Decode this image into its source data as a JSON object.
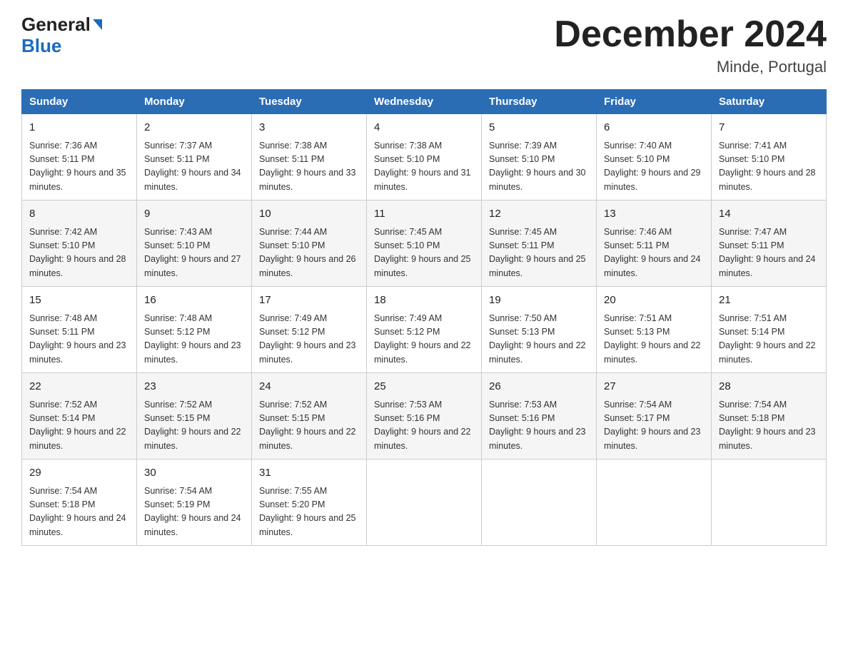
{
  "header": {
    "logo_line1": "General",
    "logo_line2": "Blue",
    "month_title": "December 2024",
    "location": "Minde, Portugal"
  },
  "days_of_week": [
    "Sunday",
    "Monday",
    "Tuesday",
    "Wednesday",
    "Thursday",
    "Friday",
    "Saturday"
  ],
  "weeks": [
    [
      {
        "day": 1,
        "sunrise": "7:36 AM",
        "sunset": "5:11 PM",
        "daylight": "9 hours and 35 minutes."
      },
      {
        "day": 2,
        "sunrise": "7:37 AM",
        "sunset": "5:11 PM",
        "daylight": "9 hours and 34 minutes."
      },
      {
        "day": 3,
        "sunrise": "7:38 AM",
        "sunset": "5:11 PM",
        "daylight": "9 hours and 33 minutes."
      },
      {
        "day": 4,
        "sunrise": "7:38 AM",
        "sunset": "5:10 PM",
        "daylight": "9 hours and 31 minutes."
      },
      {
        "day": 5,
        "sunrise": "7:39 AM",
        "sunset": "5:10 PM",
        "daylight": "9 hours and 30 minutes."
      },
      {
        "day": 6,
        "sunrise": "7:40 AM",
        "sunset": "5:10 PM",
        "daylight": "9 hours and 29 minutes."
      },
      {
        "day": 7,
        "sunrise": "7:41 AM",
        "sunset": "5:10 PM",
        "daylight": "9 hours and 28 minutes."
      }
    ],
    [
      {
        "day": 8,
        "sunrise": "7:42 AM",
        "sunset": "5:10 PM",
        "daylight": "9 hours and 28 minutes."
      },
      {
        "day": 9,
        "sunrise": "7:43 AM",
        "sunset": "5:10 PM",
        "daylight": "9 hours and 27 minutes."
      },
      {
        "day": 10,
        "sunrise": "7:44 AM",
        "sunset": "5:10 PM",
        "daylight": "9 hours and 26 minutes."
      },
      {
        "day": 11,
        "sunrise": "7:45 AM",
        "sunset": "5:10 PM",
        "daylight": "9 hours and 25 minutes."
      },
      {
        "day": 12,
        "sunrise": "7:45 AM",
        "sunset": "5:11 PM",
        "daylight": "9 hours and 25 minutes."
      },
      {
        "day": 13,
        "sunrise": "7:46 AM",
        "sunset": "5:11 PM",
        "daylight": "9 hours and 24 minutes."
      },
      {
        "day": 14,
        "sunrise": "7:47 AM",
        "sunset": "5:11 PM",
        "daylight": "9 hours and 24 minutes."
      }
    ],
    [
      {
        "day": 15,
        "sunrise": "7:48 AM",
        "sunset": "5:11 PM",
        "daylight": "9 hours and 23 minutes."
      },
      {
        "day": 16,
        "sunrise": "7:48 AM",
        "sunset": "5:12 PM",
        "daylight": "9 hours and 23 minutes."
      },
      {
        "day": 17,
        "sunrise": "7:49 AM",
        "sunset": "5:12 PM",
        "daylight": "9 hours and 23 minutes."
      },
      {
        "day": 18,
        "sunrise": "7:49 AM",
        "sunset": "5:12 PM",
        "daylight": "9 hours and 22 minutes."
      },
      {
        "day": 19,
        "sunrise": "7:50 AM",
        "sunset": "5:13 PM",
        "daylight": "9 hours and 22 minutes."
      },
      {
        "day": 20,
        "sunrise": "7:51 AM",
        "sunset": "5:13 PM",
        "daylight": "9 hours and 22 minutes."
      },
      {
        "day": 21,
        "sunrise": "7:51 AM",
        "sunset": "5:14 PM",
        "daylight": "9 hours and 22 minutes."
      }
    ],
    [
      {
        "day": 22,
        "sunrise": "7:52 AM",
        "sunset": "5:14 PM",
        "daylight": "9 hours and 22 minutes."
      },
      {
        "day": 23,
        "sunrise": "7:52 AM",
        "sunset": "5:15 PM",
        "daylight": "9 hours and 22 minutes."
      },
      {
        "day": 24,
        "sunrise": "7:52 AM",
        "sunset": "5:15 PM",
        "daylight": "9 hours and 22 minutes."
      },
      {
        "day": 25,
        "sunrise": "7:53 AM",
        "sunset": "5:16 PM",
        "daylight": "9 hours and 22 minutes."
      },
      {
        "day": 26,
        "sunrise": "7:53 AM",
        "sunset": "5:16 PM",
        "daylight": "9 hours and 23 minutes."
      },
      {
        "day": 27,
        "sunrise": "7:54 AM",
        "sunset": "5:17 PM",
        "daylight": "9 hours and 23 minutes."
      },
      {
        "day": 28,
        "sunrise": "7:54 AM",
        "sunset": "5:18 PM",
        "daylight": "9 hours and 23 minutes."
      }
    ],
    [
      {
        "day": 29,
        "sunrise": "7:54 AM",
        "sunset": "5:18 PM",
        "daylight": "9 hours and 24 minutes."
      },
      {
        "day": 30,
        "sunrise": "7:54 AM",
        "sunset": "5:19 PM",
        "daylight": "9 hours and 24 minutes."
      },
      {
        "day": 31,
        "sunrise": "7:55 AM",
        "sunset": "5:20 PM",
        "daylight": "9 hours and 25 minutes."
      },
      null,
      null,
      null,
      null
    ]
  ]
}
